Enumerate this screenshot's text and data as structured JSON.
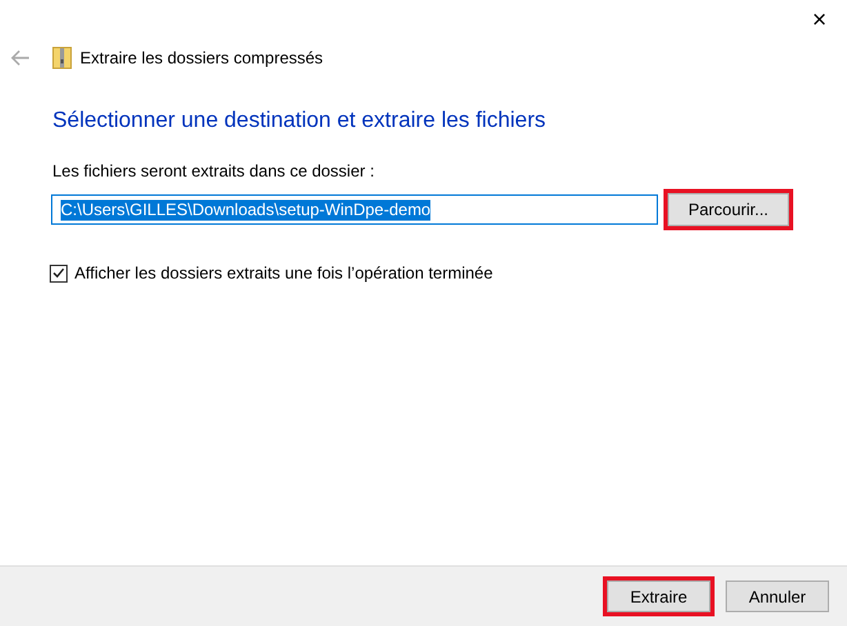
{
  "window": {
    "title": "Extraire les dossiers compressés",
    "close": "×"
  },
  "heading": "Sélectionner une destination et extraire les fichiers",
  "destination": {
    "label": "Les fichiers seront extraits dans ce dossier :",
    "value": "C:\\Users\\GILLES\\Downloads\\setup-WinDpe-demo",
    "selected": true
  },
  "browse_button": {
    "label": "Parcourir...",
    "highlighted": true
  },
  "show_files": {
    "label": "Afficher les dossiers extraits une fois l’opération terminée",
    "checked": true
  },
  "buttons": [
    {
      "label": "Extraire",
      "highlighted": true
    },
    {
      "label": "Annuler",
      "highlighted": false
    }
  ]
}
